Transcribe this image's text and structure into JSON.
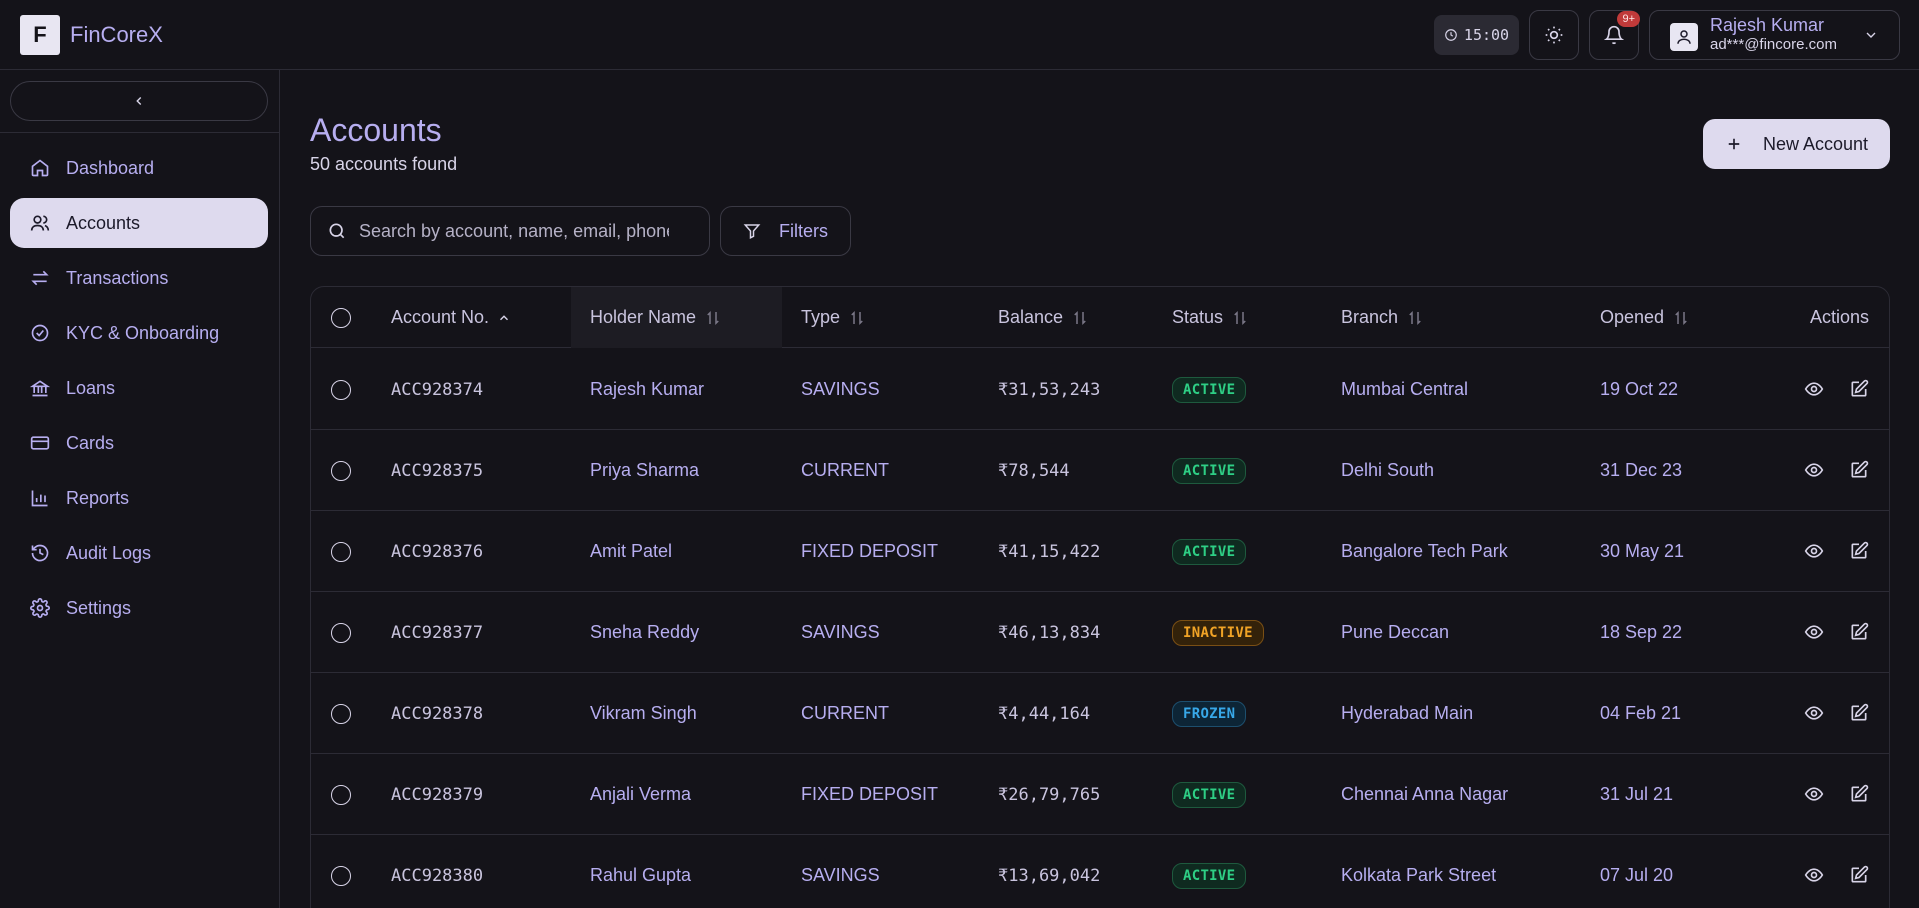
{
  "app": {
    "logo_letter": "F",
    "name": "FinCoreX"
  },
  "header": {
    "clock": "15:00",
    "notifications_badge": "9+",
    "user": {
      "name": "Rajesh Kumar",
      "email": "ad***@fincore.com"
    }
  },
  "sidebar": {
    "items": [
      {
        "label": "Dashboard",
        "icon": "home-icon",
        "active": false
      },
      {
        "label": "Accounts",
        "icon": "users-icon",
        "active": true
      },
      {
        "label": "Transactions",
        "icon": "arrows-icon",
        "active": false
      },
      {
        "label": "KYC & Onboarding",
        "icon": "check-circle-icon",
        "active": false
      },
      {
        "label": "Loans",
        "icon": "bank-icon",
        "active": false
      },
      {
        "label": "Cards",
        "icon": "card-icon",
        "active": false
      },
      {
        "label": "Reports",
        "icon": "bar-chart-icon",
        "active": false
      },
      {
        "label": "Audit Logs",
        "icon": "history-icon",
        "active": false
      },
      {
        "label": "Settings",
        "icon": "gear-icon",
        "active": false
      }
    ]
  },
  "page": {
    "title": "Accounts",
    "subtitle": "50 accounts found",
    "new_button": "New Account",
    "search_placeholder": "Search by account, name, email, phone",
    "filters_label": "Filters"
  },
  "table": {
    "headers": {
      "account_no": "Account No.",
      "holder_name": "Holder Name",
      "type": "Type",
      "balance": "Balance",
      "status": "Status",
      "branch": "Branch",
      "opened": "Opened",
      "actions": "Actions"
    },
    "rows": [
      {
        "account": "ACC928374",
        "holder": "Rajesh Kumar",
        "type": "SAVINGS",
        "balance": "₹31,53,243",
        "status": "ACTIVE",
        "status_kind": "active",
        "branch": "Mumbai Central",
        "opened": "19 Oct 22"
      },
      {
        "account": "ACC928375",
        "holder": "Priya Sharma",
        "type": "CURRENT",
        "balance": "₹78,544",
        "status": "ACTIVE",
        "status_kind": "active",
        "branch": "Delhi South",
        "opened": "31 Dec 23"
      },
      {
        "account": "ACC928376",
        "holder": "Amit Patel",
        "type": "FIXED DEPOSIT",
        "balance": "₹41,15,422",
        "status": "ACTIVE",
        "status_kind": "active",
        "branch": "Bangalore Tech Park",
        "opened": "30 May 21"
      },
      {
        "account": "ACC928377",
        "holder": "Sneha Reddy",
        "type": "SAVINGS",
        "balance": "₹46,13,834",
        "status": "INACTIVE",
        "status_kind": "inactive",
        "branch": "Pune Deccan",
        "opened": "18 Sep 22"
      },
      {
        "account": "ACC928378",
        "holder": "Vikram Singh",
        "type": "CURRENT",
        "balance": "₹4,44,164",
        "status": "FROZEN",
        "status_kind": "frozen",
        "branch": "Hyderabad Main",
        "opened": "04 Feb 21"
      },
      {
        "account": "ACC928379",
        "holder": "Anjali Verma",
        "type": "FIXED DEPOSIT",
        "balance": "₹26,79,765",
        "status": "ACTIVE",
        "status_kind": "active",
        "branch": "Chennai Anna Nagar",
        "opened": "31 Jul 21"
      },
      {
        "account": "ACC928380",
        "holder": "Rahul Gupta",
        "type": "SAVINGS",
        "balance": "₹13,69,042",
        "status": "ACTIVE",
        "status_kind": "active",
        "branch": "Kolkata Park Street",
        "opened": "07 Jul 20"
      }
    ]
  },
  "colors": {
    "accent": "#b7aef0",
    "background": "#141319",
    "active_status": "#2ecf85",
    "inactive_status": "#f0a326",
    "frozen_status": "#38a8e8"
  }
}
